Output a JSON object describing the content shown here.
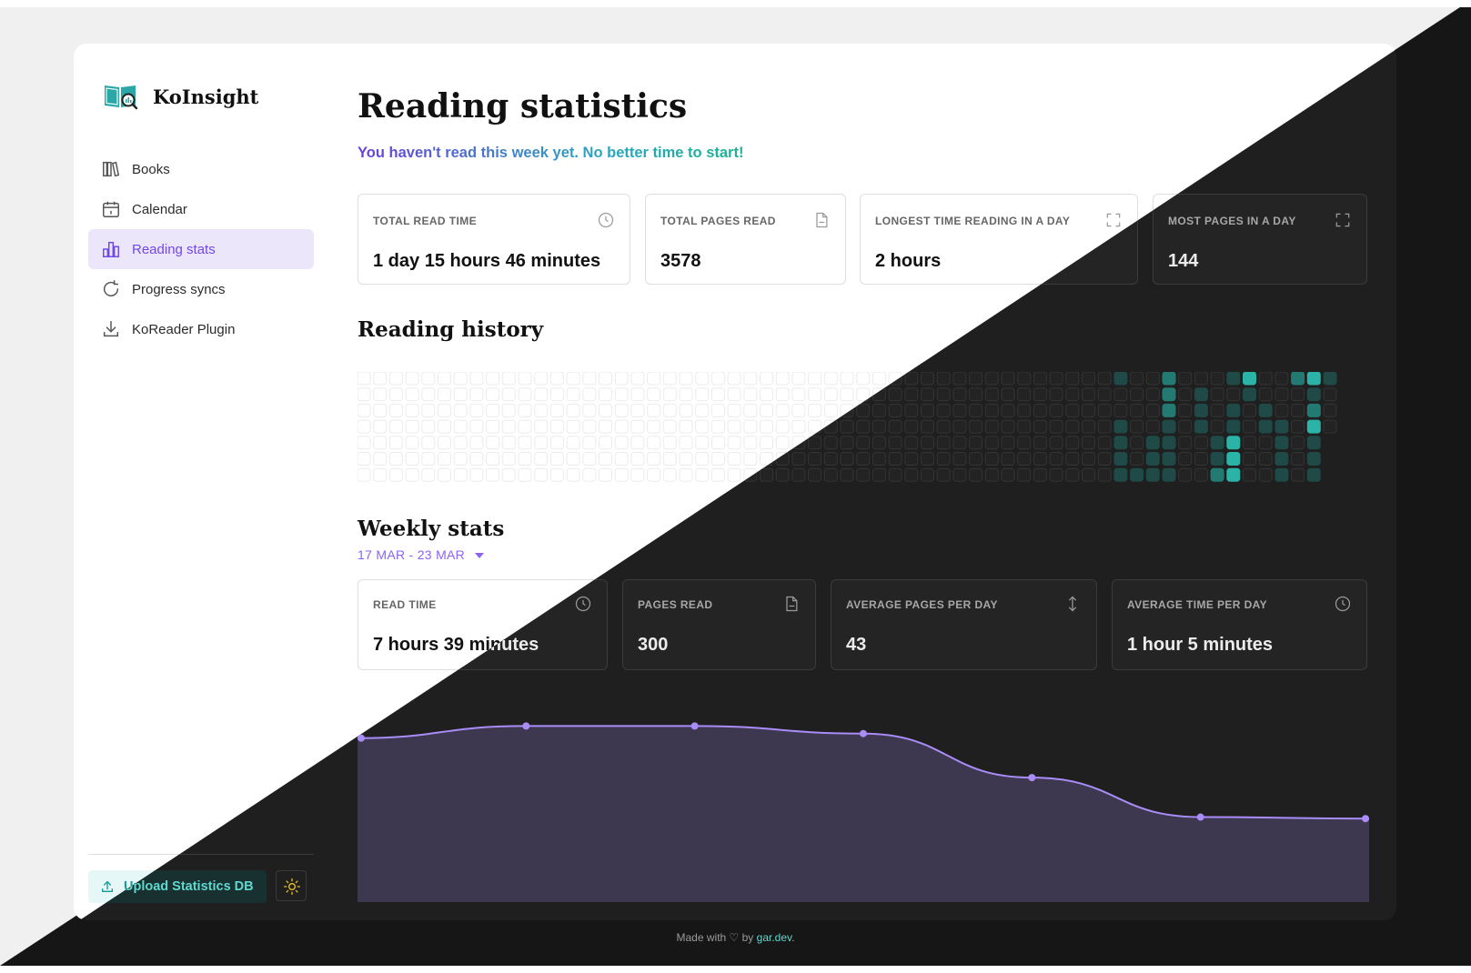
{
  "app": {
    "name": "KoInsight"
  },
  "sidebar": {
    "items": [
      {
        "label": "Books",
        "icon": "books-icon"
      },
      {
        "label": "Calendar",
        "icon": "calendar-icon"
      },
      {
        "label": "Reading stats",
        "icon": "bar-chart-icon",
        "active": true
      },
      {
        "label": "Progress syncs",
        "icon": "refresh-icon"
      },
      {
        "label": "KoReader Plugin",
        "icon": "download-icon"
      }
    ],
    "upload_label": "Upload Statistics DB",
    "theme_toggle_icon": "sun-icon"
  },
  "page": {
    "title": "Reading statistics",
    "subtitle": "You haven't read this week yet. No better time to start!"
  },
  "stats": [
    {
      "label": "TOTAL READ TIME",
      "value": "1 day 15 hours 46 minutes",
      "icon": "clock-icon"
    },
    {
      "label": "TOTAL PAGES READ",
      "value": "3578",
      "icon": "page-icon"
    },
    {
      "label": "LONGEST TIME READING IN A DAY",
      "value": "2 hours",
      "icon": "expand-icon"
    },
    {
      "label": "MOST PAGES IN A DAY",
      "value": "144",
      "icon": "expand-icon"
    }
  ],
  "history": {
    "title": "Reading history"
  },
  "weekly": {
    "title": "Weekly stats",
    "range": "17 MAR - 23 MAR",
    "cards": [
      {
        "label": "READ TIME",
        "value": "7 hours 39 minutes",
        "icon": "clock-icon"
      },
      {
        "label": "PAGES READ",
        "value": "300",
        "icon": "page-icon"
      },
      {
        "label": "AVERAGE PAGES PER DAY",
        "value": "43",
        "icon": "arrows-vertical-icon"
      },
      {
        "label": "AVERAGE TIME PER DAY",
        "value": "1 hour 5 minutes",
        "icon": "clock-icon"
      }
    ]
  },
  "chart_data": {
    "type": "area",
    "x": [
      1,
      2,
      3,
      4,
      5,
      6,
      7
    ],
    "values": [
      108,
      116,
      116,
      111,
      82,
      56,
      55
    ],
    "ylim": [
      0,
      130
    ],
    "grid": false,
    "line_color": "#a98cf7",
    "fill_color": "#3d3750"
  },
  "footer": {
    "prefix": "Made with ♡ by ",
    "link": "gar.dev",
    "suffix": "."
  },
  "colors": {
    "accent": "#7048e8",
    "teal": "#159c97",
    "dark_teal_cells": [
      "#1f4a47",
      "#237a73",
      "#2bb3a7"
    ]
  }
}
